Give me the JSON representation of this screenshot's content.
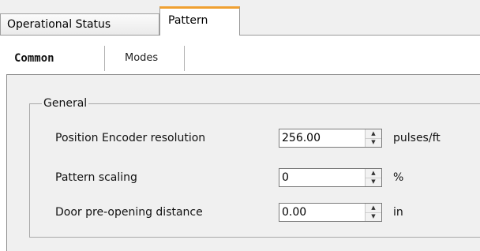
{
  "tabs": [
    {
      "label": "Operational Status",
      "active": false
    },
    {
      "label": "Pattern",
      "active": true
    }
  ],
  "subtabs": [
    {
      "label": "Common",
      "active": true
    },
    {
      "label": "Modes",
      "active": false
    }
  ],
  "group": {
    "title": "General",
    "rows": [
      {
        "label": "Position Encoder resolution",
        "value": "256.00",
        "unit": "pulses/ft"
      },
      {
        "label": "Pattern scaling",
        "value": "0",
        "unit": "%"
      },
      {
        "label": "Door pre-opening distance",
        "value": "0.00",
        "unit": "in"
      }
    ]
  },
  "colors": {
    "active_tab_accent": "#f0a030",
    "panel_bg": "#f0f0f0"
  },
  "icons": {
    "spin_up": "spin-up-icon",
    "spin_down": "spin-down-icon"
  }
}
